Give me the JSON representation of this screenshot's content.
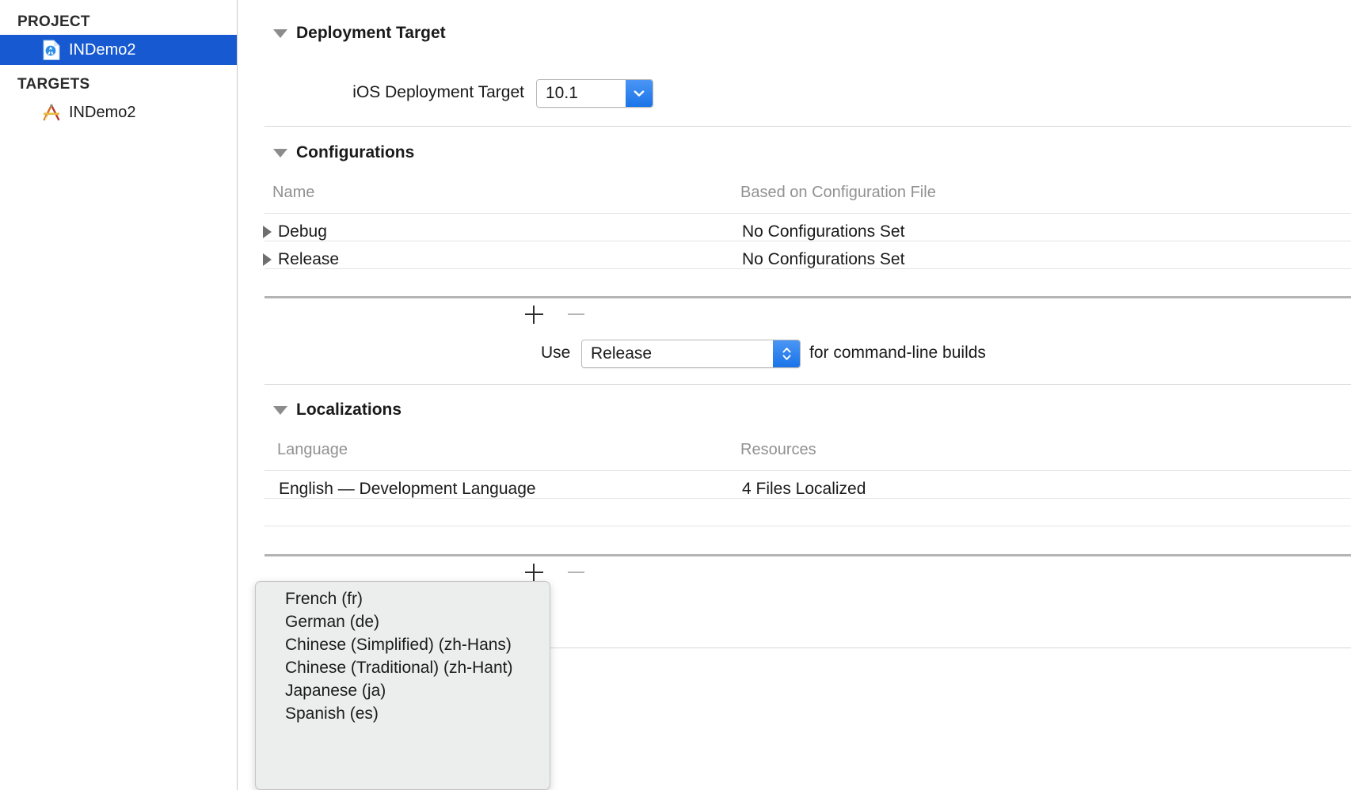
{
  "sidebar": {
    "groups": [
      {
        "header": "PROJECT",
        "items": [
          {
            "label": "INDemo2",
            "icon": "xcode-project-icon",
            "selected": true
          }
        ]
      },
      {
        "header": "TARGETS",
        "items": [
          {
            "label": "INDemo2",
            "icon": "xcode-target-app-icon",
            "selected": false
          }
        ]
      }
    ]
  },
  "main": {
    "deployment_target": {
      "title": "Deployment Target",
      "field_label": "iOS Deployment Target",
      "value": "10.1"
    },
    "configurations": {
      "title": "Configurations",
      "columns": {
        "name": "Name",
        "based_on": "Based on Configuration File"
      },
      "rows": [
        {
          "name": "Debug",
          "based_on": "No Configurations Set"
        },
        {
          "name": "Release",
          "based_on": "No Configurations Set"
        }
      ],
      "add_label": "+",
      "remove_label": "−",
      "command_line": {
        "prefix": "Use",
        "value": "Release",
        "suffix": "for command-line builds"
      }
    },
    "localizations": {
      "title": "Localizations",
      "columns": {
        "language": "Language",
        "resources": "Resources"
      },
      "rows": [
        {
          "language": "English — Development Language",
          "resources": "4 Files Localized"
        }
      ],
      "add_label": "+",
      "remove_label": "−",
      "popup_menu": {
        "items": [
          "French (fr)",
          "German (de)",
          "Chinese (Simplified) (zh-Hans)",
          "Chinese (Traditional) (zh-Hant)",
          "Japanese (ja)",
          "Spanish (es)"
        ]
      }
    }
  },
  "colors": {
    "selection_blue": "#1659d1",
    "control_blue": "#1a74e8",
    "divider": "#d6d6d6",
    "muted_text": "#919191"
  }
}
